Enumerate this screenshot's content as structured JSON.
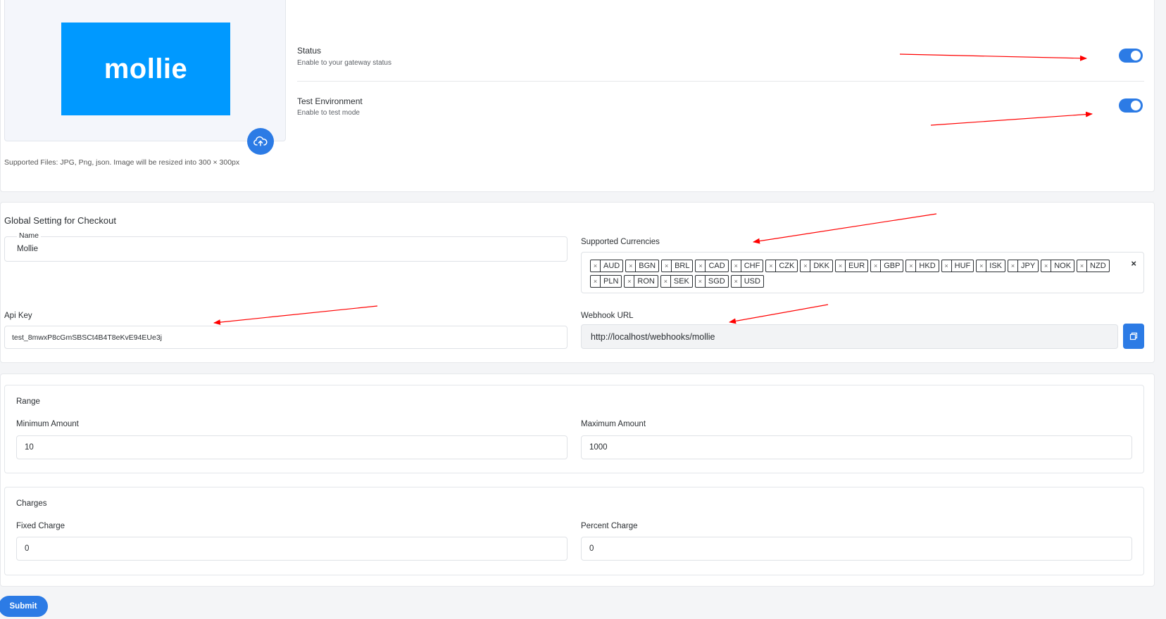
{
  "logo": {
    "text": "mollie",
    "bg_color": "#0099ff"
  },
  "upload_hint": "Supported Files: JPG, Png, json. Image will be resized into 300 × 300px",
  "options": {
    "status": {
      "title": "Status",
      "subtitle": "Enable to your gateway status",
      "enabled": true
    },
    "test_env": {
      "title": "Test Environment",
      "subtitle": "Enable to test mode",
      "enabled": true
    }
  },
  "global": {
    "title": "Global Setting for Checkout",
    "name_label": "Name",
    "name_value": "Mollie",
    "currencies_label": "Supported Currencies",
    "currencies": [
      "AUD",
      "BGN",
      "BRL",
      "CAD",
      "CHF",
      "CZK",
      "DKK",
      "EUR",
      "GBP",
      "HKD",
      "HUF",
      "ISK",
      "JPY",
      "NOK",
      "NZD",
      "PLN",
      "RON",
      "SEK",
      "SGD",
      "USD"
    ],
    "clear_all": "×",
    "chip_remove": "×",
    "api_key_label": "Api Key",
    "api_key_value": "test_8mwxP8cGmSBSCt4B4T8eKvE94EUe3j",
    "webhook_label": "Webhook URL",
    "webhook_value": "http://localhost/webhooks/mollie"
  },
  "range": {
    "title": "Range",
    "min_label": "Minimum Amount",
    "min_value": "10",
    "max_label": "Maximum Amount",
    "max_value": "1000"
  },
  "charges": {
    "title": "Charges",
    "fixed_label": "Fixed Charge",
    "fixed_value": "0",
    "percent_label": "Percent Charge",
    "percent_value": "0"
  },
  "submit_label": "Submit",
  "colors": {
    "accent": "#2c7be5",
    "annotation": "#ff0000"
  }
}
